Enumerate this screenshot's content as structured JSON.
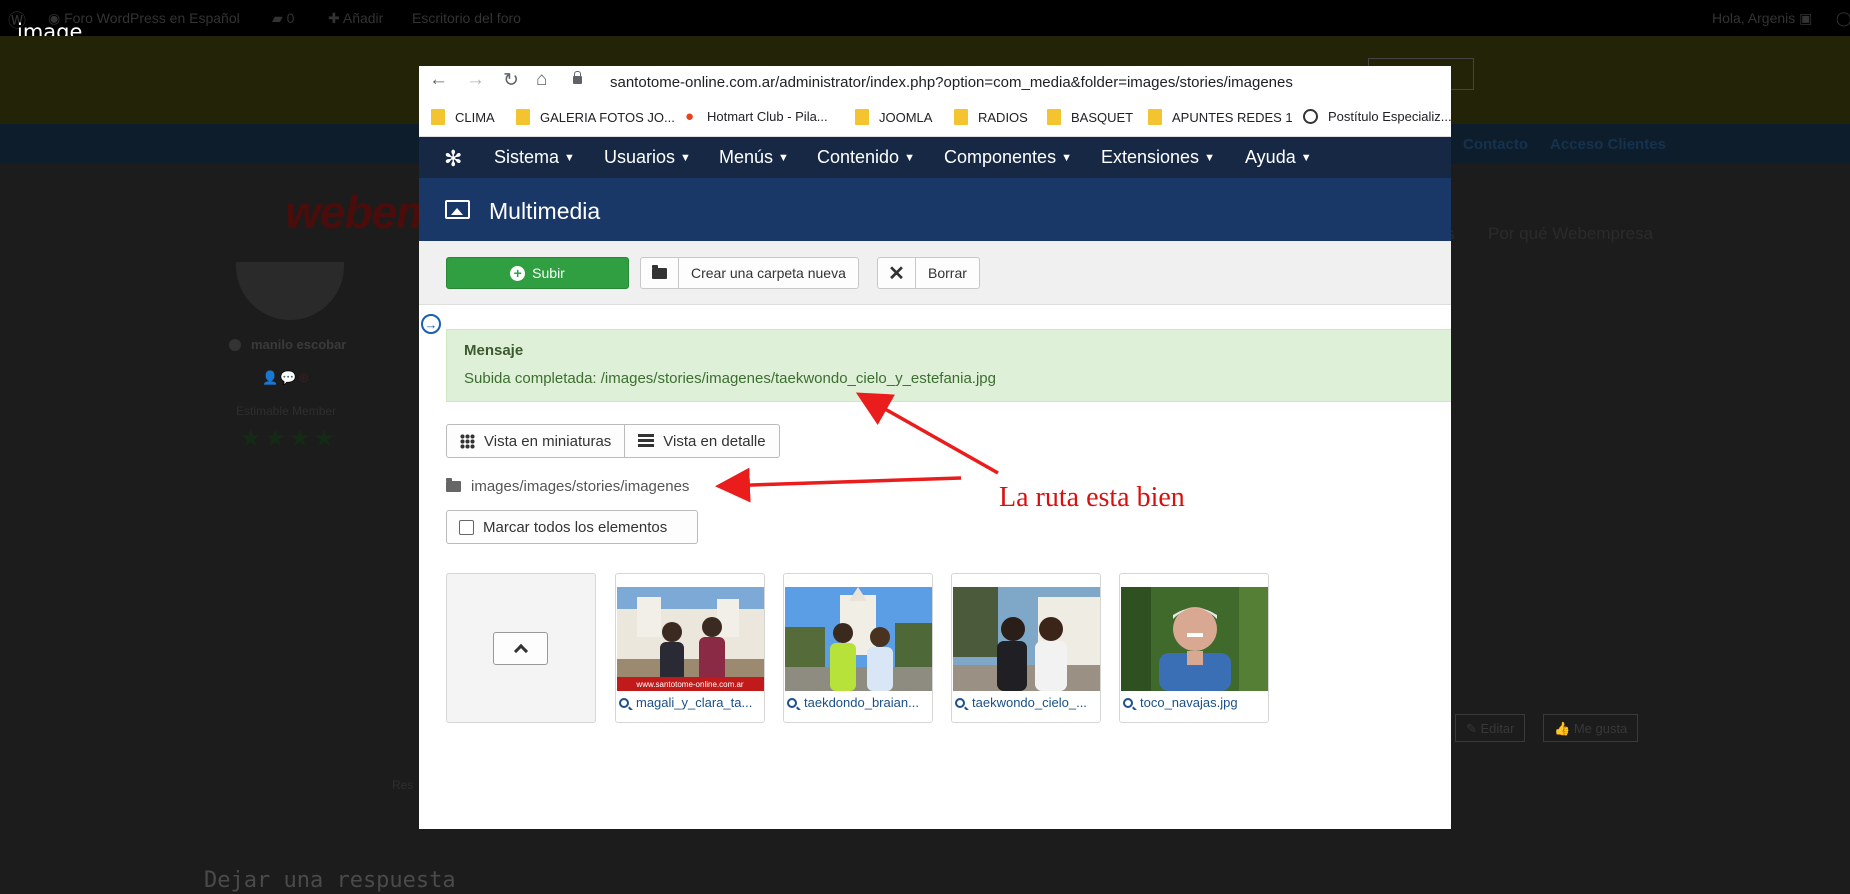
{
  "image_label": "image",
  "background": {
    "wp_bar": {
      "site_name": "Foro WordPress en Español",
      "comments": "0",
      "add": "Añadir",
      "dashboard": "Escritorio del foro",
      "greeting": "Hola, Argenis"
    },
    "nav": {
      "contact": "Contacto",
      "clients": "Acceso Clientes"
    },
    "logo": "webem",
    "links": {
      "partial": "s",
      "why": "Por qué Webempresa"
    },
    "user": {
      "name": "manilo escobar",
      "role": "Estimable Member",
      "stars": "★★★★"
    },
    "buttons": {
      "edit": "Editar",
      "like": "Me gusta"
    },
    "res": "Res",
    "reply_heading": "Dejar una respuesta"
  },
  "browser": {
    "url": "santotome-online.com.ar/administrator/index.php?option=com_media&folder=images/stories/imagenes",
    "bookmarks": [
      {
        "label": "CLIMA",
        "icon": "folder-icon"
      },
      {
        "label": "GALERIA FOTOS JO...",
        "icon": "folder-icon"
      },
      {
        "label": "Hotmart Club - Pila...",
        "icon": "flame-icon"
      },
      {
        "label": "JOOMLA",
        "icon": "folder-icon"
      },
      {
        "label": "RADIOS",
        "icon": "folder-icon"
      },
      {
        "label": "BASQUET",
        "icon": "folder-icon"
      },
      {
        "label": "APUNTES REDES 1",
        "icon": "folder-icon"
      },
      {
        "label": "Postítulo Especializ...",
        "icon": "globe-icon"
      }
    ]
  },
  "joomla": {
    "menu": [
      "Sistema",
      "Usuarios",
      "Menús",
      "Contenido",
      "Componentes",
      "Extensiones",
      "Ayuda"
    ],
    "header_title": "Multimedia",
    "toolbar": {
      "upload": "Subir",
      "new_folder": "Crear una carpeta nueva",
      "delete": "Borrar"
    },
    "message": {
      "heading": "Mensaje",
      "body": "Subida completada: /images/stories/imagenes/taekwondo_cielo_y_estefania.jpg"
    },
    "views": {
      "thumbnails": "Vista en miniaturas",
      "detail": "Vista en detalle"
    },
    "path": "images/images/stories/imagenes",
    "select_all": "Marcar todos los elementos",
    "files": [
      {
        "name": "magali_y_clara_ta...",
        "watermark": "www.santotome-online.com.ar"
      },
      {
        "name": "taekdondo_braian..."
      },
      {
        "name": "taekwondo_cielo_..."
      },
      {
        "name": "toco_navajas.jpg"
      }
    ]
  },
  "annotation": {
    "text": "La ruta esta bien",
    "color": "#d8110e"
  }
}
